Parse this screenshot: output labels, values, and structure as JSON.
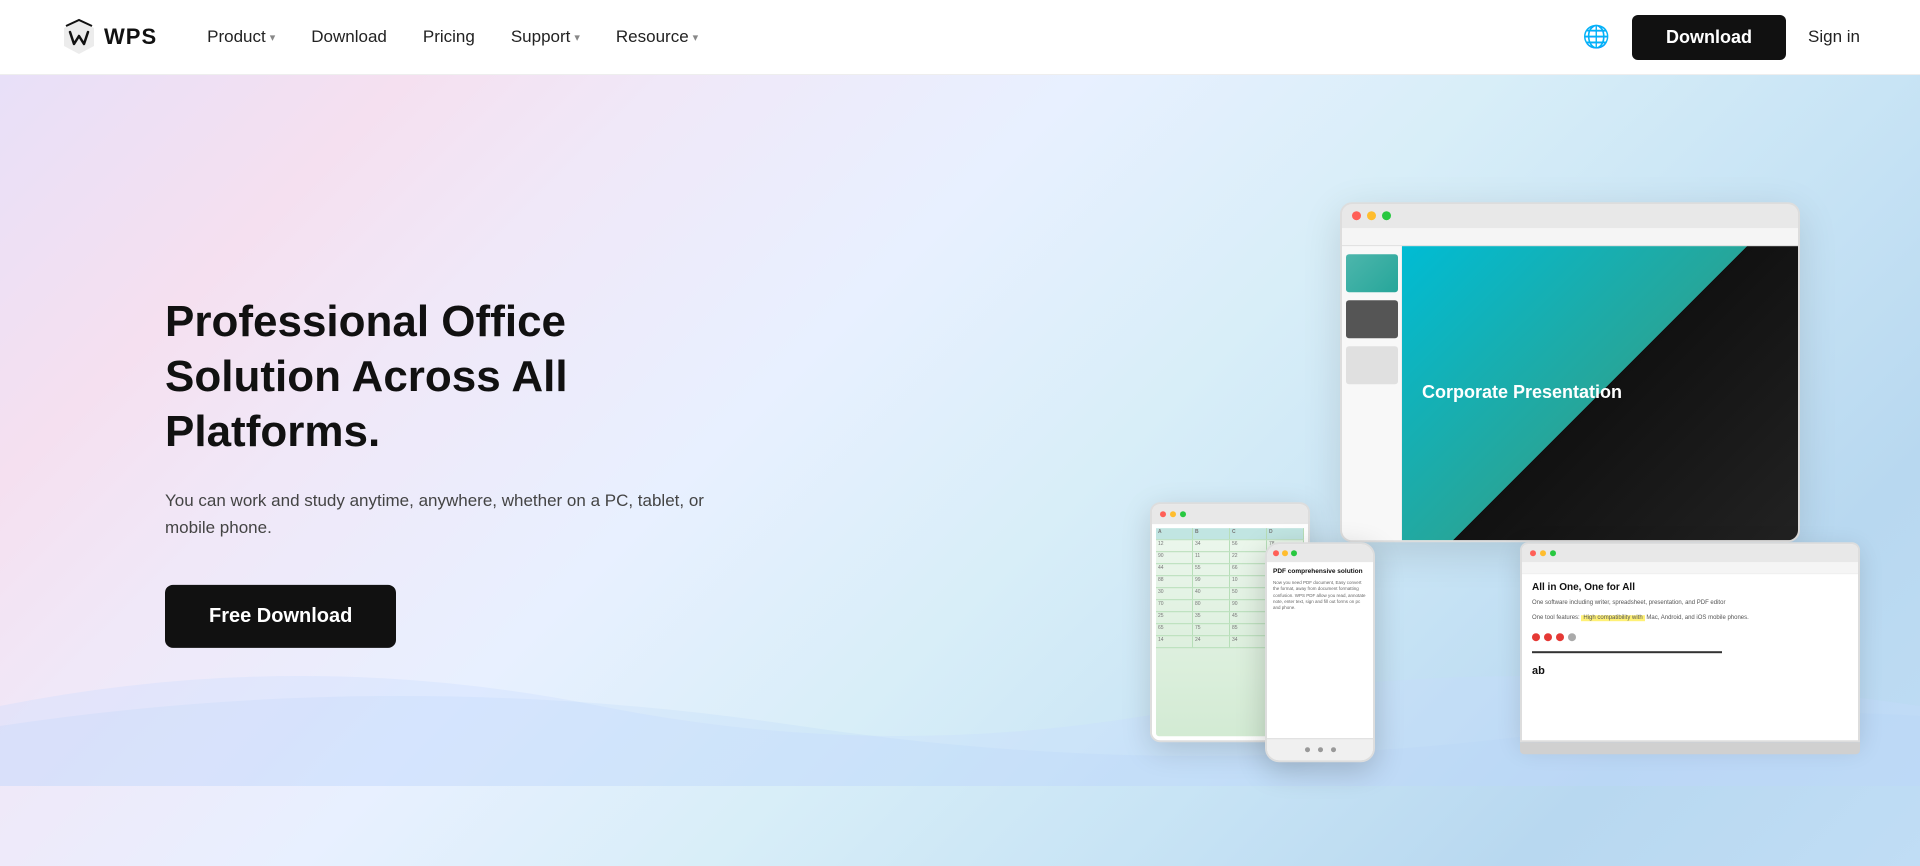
{
  "logo": {
    "text": "WPS"
  },
  "nav": {
    "product_label": "Product",
    "download_label": "Download",
    "pricing_label": "Pricing",
    "support_label": "Support",
    "resource_label": "Resource",
    "download_btn": "Download",
    "signin_label": "Sign in"
  },
  "hero": {
    "title": "Professional Office Solution Across All Platforms.",
    "subtitle": "You can work and study anytime, anywhere, whether on a PC, tablet, or mobile phone.",
    "cta_label": "Free Download"
  },
  "devices": {
    "slide_title": "Corporate Presentation",
    "laptop_doc_title": "All in One, One for All",
    "laptop_doc_subtitle": "One software including writer, spreadsheet, presentation, and PDF editor",
    "phone_pdf_title": "PDF comprehensive solution",
    "phone_pdf_body": "Now you need PDF document, Easy convert the format, away from document formatting confusion. WPS PDF allow you read, annotate note, enter text, sign and fill out forms on pc and phone."
  }
}
